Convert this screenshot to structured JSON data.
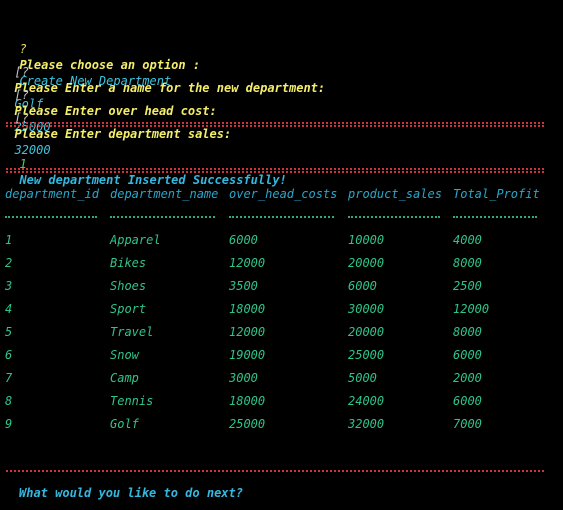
{
  "prompts": [
    {
      "marker": "?",
      "question": "Please choose an option :",
      "answer": "Create New Department"
    },
    {
      "marker": "[?",
      "question": "Please Enter a name for the new department:",
      "answer": "Golf"
    },
    {
      "marker": "[?",
      "question": "Please Enter over head cost:",
      "answer": "25000"
    },
    {
      "marker": "[?",
      "question": "Please Enter department sales:",
      "answer": "32000"
    }
  ],
  "success": {
    "number": "1",
    "message": "New department Inserted Successfully!"
  },
  "table": {
    "columns": [
      "department_id",
      "department_name",
      "over_head_costs",
      "product_sales",
      "Total_Profit"
    ],
    "rows": [
      [
        "1",
        "Apparel",
        "6000",
        "10000",
        "4000"
      ],
      [
        "2",
        "Bikes",
        "12000",
        "20000",
        "8000"
      ],
      [
        "3",
        "Shoes",
        "3500",
        "6000",
        "2500"
      ],
      [
        "4",
        "Sport",
        "18000",
        "30000",
        "12000"
      ],
      [
        "5",
        "Travel",
        "12000",
        "20000",
        "8000"
      ],
      [
        "6",
        "Snow",
        "19000",
        "25000",
        "6000"
      ],
      [
        "7",
        "Camp",
        "3000",
        "5000",
        "2000"
      ],
      [
        "8",
        "Tennis",
        "18000",
        "24000",
        "6000"
      ],
      [
        "9",
        "Golf",
        "25000",
        "32000",
        "7000"
      ]
    ]
  },
  "next_prompt": "What would you like to do next?",
  "colors": {
    "background": "#000000",
    "prompt": "#f4ee6a",
    "answer": "#3cc6e0",
    "separator": "#d0313a",
    "table_text": "#2fc48a",
    "header_text": "#2aa6c8"
  }
}
